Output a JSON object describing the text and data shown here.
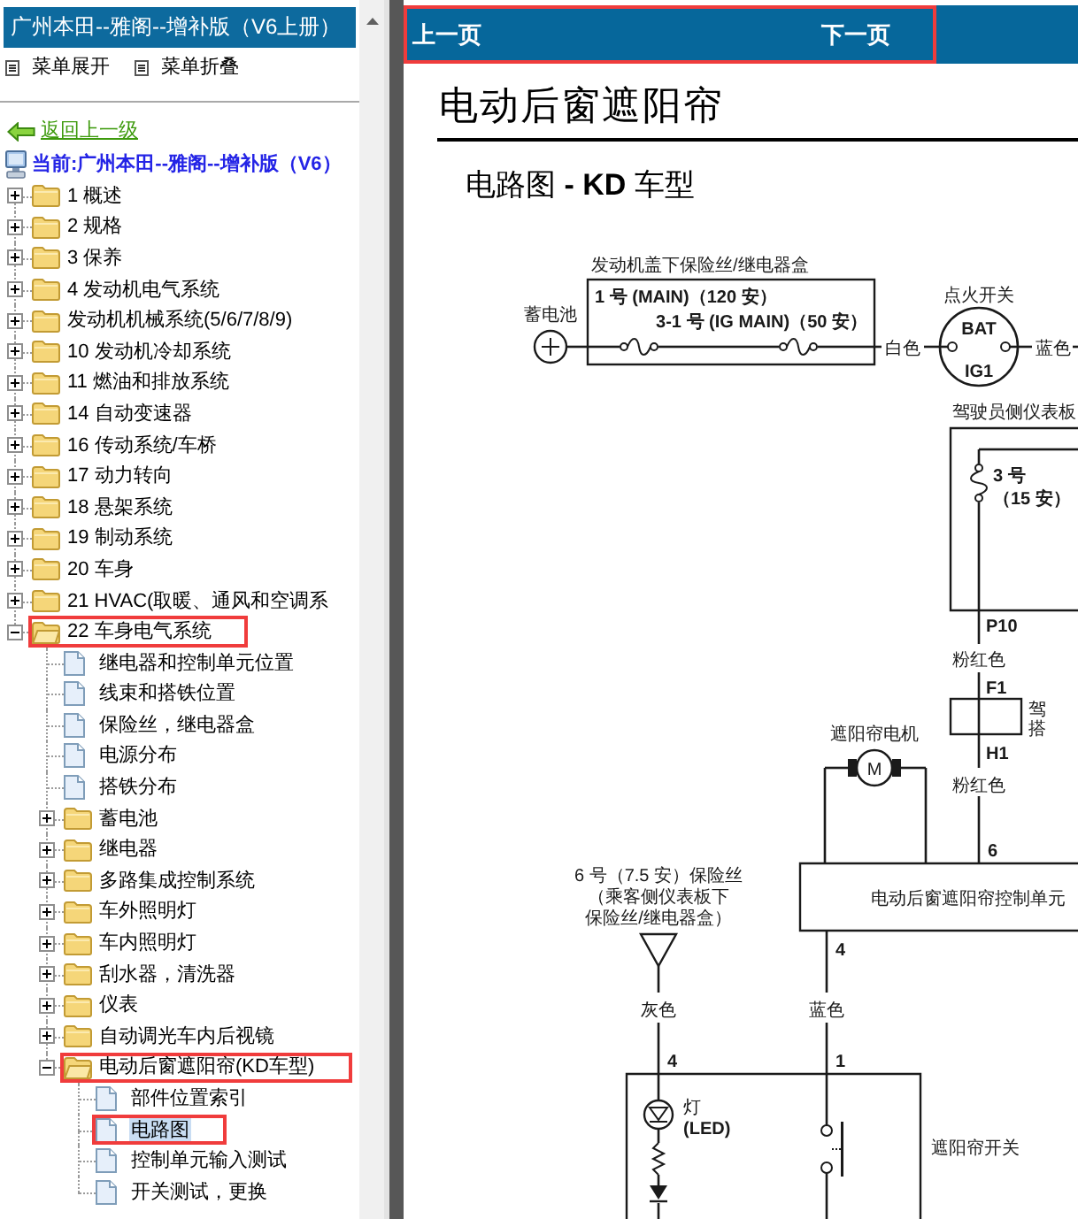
{
  "sidebar": {
    "title": "广州本田--雅阁--增补版（V6上册）",
    "menu_actions": [
      "菜单展开",
      "菜单折叠"
    ],
    "back_link": "返回上一级",
    "current_location": "当前:广州本田--雅阁--增补版（V6）",
    "tree": [
      {
        "label": "1 概述",
        "kind": "folder",
        "expanded": false,
        "selected": false,
        "marked": false
      },
      {
        "label": "2 规格",
        "kind": "folder",
        "expanded": false,
        "selected": false,
        "marked": false
      },
      {
        "label": "3 保养",
        "kind": "folder",
        "expanded": false,
        "selected": false,
        "marked": false
      },
      {
        "label": "4 发动机电气系统",
        "kind": "folder",
        "expanded": false,
        "selected": false,
        "marked": false
      },
      {
        "label": "发动机机械系统(5/6/7/8/9)",
        "kind": "folder",
        "expanded": false,
        "selected": false,
        "marked": false
      },
      {
        "label": "10 发动机冷却系统",
        "kind": "folder",
        "expanded": false,
        "selected": false,
        "marked": false
      },
      {
        "label": "11 燃油和排放系统",
        "kind": "folder",
        "expanded": false,
        "selected": false,
        "marked": false
      },
      {
        "label": "14 自动变速器",
        "kind": "folder",
        "expanded": false,
        "selected": false,
        "marked": false
      },
      {
        "label": "16 传动系统/车桥",
        "kind": "folder",
        "expanded": false,
        "selected": false,
        "marked": false
      },
      {
        "label": "17 动力转向",
        "kind": "folder",
        "expanded": false,
        "selected": false,
        "marked": false
      },
      {
        "label": "18 悬架系统",
        "kind": "folder",
        "expanded": false,
        "selected": false,
        "marked": false
      },
      {
        "label": "19 制动系统",
        "kind": "folder",
        "expanded": false,
        "selected": false,
        "marked": false
      },
      {
        "label": "20 车身",
        "kind": "folder",
        "expanded": false,
        "selected": false,
        "marked": false
      },
      {
        "label": "21 HVAC(取暖、通风和空调系",
        "kind": "folder",
        "expanded": false,
        "selected": false,
        "marked": false
      },
      {
        "label": "22 车身电气系统",
        "kind": "folder",
        "expanded": true,
        "selected": false,
        "marked": true,
        "children": [
          {
            "label": "继电器和控制单元位置",
            "kind": "page",
            "selected": false,
            "marked": false
          },
          {
            "label": "线束和搭铁位置",
            "kind": "page",
            "selected": false,
            "marked": false
          },
          {
            "label": "保险丝，继电器盒",
            "kind": "page",
            "selected": false,
            "marked": false
          },
          {
            "label": "电源分布",
            "kind": "page",
            "selected": false,
            "marked": false
          },
          {
            "label": "搭铁分布",
            "kind": "page",
            "selected": false,
            "marked": false
          },
          {
            "label": "蓄电池",
            "kind": "folder",
            "expanded": false,
            "selected": false,
            "marked": false
          },
          {
            "label": "继电器",
            "kind": "folder",
            "expanded": false,
            "selected": false,
            "marked": false
          },
          {
            "label": "多路集成控制系统",
            "kind": "folder",
            "expanded": false,
            "selected": false,
            "marked": false
          },
          {
            "label": "车外照明灯",
            "kind": "folder",
            "expanded": false,
            "selected": false,
            "marked": false
          },
          {
            "label": "车内照明灯",
            "kind": "folder",
            "expanded": false,
            "selected": false,
            "marked": false
          },
          {
            "label": "刮水器，清洗器",
            "kind": "folder",
            "expanded": false,
            "selected": false,
            "marked": false
          },
          {
            "label": "仪表",
            "kind": "folder",
            "expanded": false,
            "selected": false,
            "marked": false
          },
          {
            "label": "自动调光车内后视镜",
            "kind": "folder",
            "expanded": false,
            "selected": false,
            "marked": false
          },
          {
            "label": "电动后窗遮阳帘(KD车型)",
            "kind": "folder",
            "expanded": true,
            "selected": false,
            "marked": true,
            "children": [
              {
                "label": "部件位置索引",
                "kind": "page",
                "selected": false,
                "marked": false
              },
              {
                "label": "电路图",
                "kind": "page",
                "selected": true,
                "marked": true
              },
              {
                "label": "控制单元输入测试",
                "kind": "page",
                "selected": false,
                "marked": false
              },
              {
                "label": "开关测试，更换",
                "kind": "page",
                "selected": false,
                "marked": false
              }
            ]
          }
        ]
      }
    ]
  },
  "page_nav": {
    "marked": true,
    "previous": "上一页",
    "next": "下一页"
  },
  "document": {
    "title": "电动后窗遮阳帘",
    "subtitle": "电路图 **- KD** 车型",
    "diagram": {
      "battery": "蓄电池",
      "underhood_fuse_box": {
        "label": "发动机盖下保险丝/继电器盒",
        "fuses": [
          "1 号 (MAIN)（120 安）",
          "3-1 号 (IG MAIN)（50 安）"
        ]
      },
      "battery_wire_color": "白色",
      "ignition_switch": {
        "label": "点火开关",
        "terminals": [
          "BAT",
          "IG1"
        ]
      },
      "ignition_wire_color": "蓝色",
      "dash_fuse_box": {
        "label": "驾驶员侧仪表板",
        "fuse": "3 号",
        "fuse_rating": "（15 安）"
      },
      "feed_line": {
        "connector_top": "P10",
        "upper_wire_color": "粉红色",
        "splice_top": "F1",
        "splice_labels": [
          "驾",
          "搭"
        ],
        "splice_bottom": "H1",
        "lower_wire_color": "粉红色",
        "unit_pin": "6"
      },
      "motor": {
        "label": "遮阳帘电机",
        "symbol": "M"
      },
      "control_unit": {
        "label": "电动后窗遮阳帘控制单元",
        "switch_pin": "4",
        "switch_wire_color": "蓝色"
      },
      "indicator_fuse": {
        "label": [
          "6 号（7.5 安）保险丝",
          "（乘客侧仪表板下",
          "保险丝/继电器盒）"
        ],
        "wire_color": "灰色",
        "pin": "4"
      },
      "shade_switch": {
        "label": "遮阳帘开关",
        "pin": "1",
        "lamp": "灯",
        "lamp_type": "(LED)"
      }
    }
  }
}
